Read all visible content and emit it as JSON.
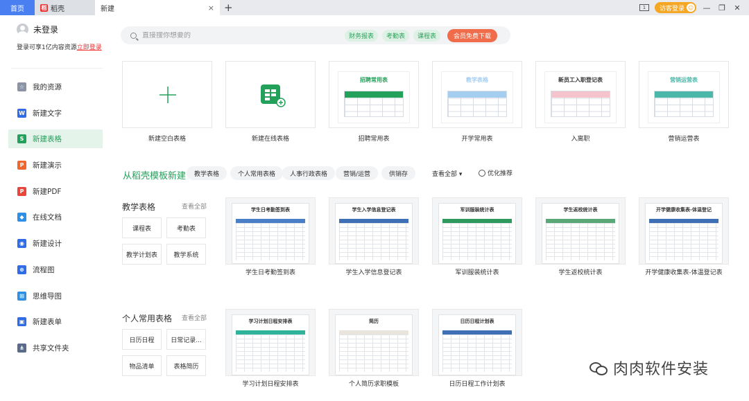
{
  "tabs": {
    "home": "首页",
    "docer": "稻壳",
    "active": "新建",
    "close": "×",
    "add": "+"
  },
  "topbar": {
    "guest_login": "访客登录",
    "min": "—",
    "max": "❐",
    "close": "✕",
    "win_label": "1"
  },
  "user": {
    "name": "未登录",
    "tip": "登录可享1亿内容资源",
    "login_link": "立即登录"
  },
  "nav": [
    {
      "label": "我的资源",
      "color": "#8a94a6",
      "glyph": "☆"
    },
    {
      "label": "新建文字",
      "color": "#2f6ce5",
      "glyph": "W"
    },
    {
      "label": "新建表格",
      "color": "#23a05a",
      "glyph": "S"
    },
    {
      "label": "新建演示",
      "color": "#f0662f",
      "glyph": "P"
    },
    {
      "label": "新建PDF",
      "color": "#e8453c",
      "glyph": "P"
    },
    {
      "label": "在线文档",
      "color": "#2f8fe5",
      "glyph": "◆"
    },
    {
      "label": "新建设计",
      "color": "#2f6ce5",
      "glyph": "◉"
    },
    {
      "label": "流程图",
      "color": "#2f6ce5",
      "glyph": "⊕"
    },
    {
      "label": "思维导图",
      "color": "#2f8fe5",
      "glyph": "⊞"
    },
    {
      "label": "新建表单",
      "color": "#2f6ce5",
      "glyph": "▣"
    },
    {
      "label": "共享文件夹",
      "color": "#5a6a8a",
      "glyph": "⋔"
    }
  ],
  "search": {
    "placeholder": "直接搜你想要的",
    "chips": [
      "财务报表",
      "考勤表",
      "课程表"
    ],
    "vip": "会员免费下载"
  },
  "top_cards": [
    {
      "label": "新建空白表格"
    },
    {
      "label": "新建在线表格"
    },
    {
      "label": "招聘常用表",
      "title": "招聘常用表",
      "accent": "#23a05a"
    },
    {
      "label": "开学常用表",
      "title": "教学表格",
      "accent": "#a5cdf0"
    },
    {
      "label": "入离职",
      "title": "新员工入职登记表",
      "accent": "#f4c3cc"
    },
    {
      "label": "营销运营表",
      "title": "营销运营表",
      "accent": "#4bb7a8"
    }
  ],
  "template_section": {
    "title": "从稻壳模板新建",
    "categories": [
      "教学表格",
      "个人常用表格",
      "人事行政表格",
      "营销/运营",
      "供销存",
      "查看全部 ▾"
    ],
    "optimize": "优化推荐"
  },
  "group1": {
    "title": "教学表格",
    "more": "查看全部",
    "minis": [
      "课程表",
      "考勤表",
      "教学计划表",
      "教学系统"
    ],
    "templates": [
      {
        "label": "学生日考勤签到表",
        "title": "学生日考勤签到表",
        "hdr": "#4a7fc7"
      },
      {
        "label": "学生入学信息登记表",
        "title": "学生入学信息登记表",
        "hdr": "#3f6fb5"
      },
      {
        "label": "军训服装统计表",
        "title": "军训服装统计表",
        "hdr": "#2f9a5e"
      },
      {
        "label": "学生返校统计表",
        "title": "学生返校统计表",
        "hdr": "#5aa878"
      },
      {
        "label": "开学健康收集表-体温登记表",
        "title": "开学健康收集表-体温登记",
        "hdr": "#3f6fb5"
      }
    ]
  },
  "group2": {
    "title": "个人常用表格",
    "more": "查看全部",
    "minis": [
      "日历日程",
      "日常记录...",
      "物品清单",
      "表格简历"
    ],
    "templates": [
      {
        "label": "学习计划日程安排表",
        "title": "学习计划日程安排表",
        "hdr": "#2fb39a"
      },
      {
        "label": "个人简历求职模板",
        "title": "简历",
        "hdr": "#e9e4dc"
      },
      {
        "label": "日历日程工作计划表",
        "title": "日历日程计划表",
        "hdr": "#3f6fb5"
      }
    ]
  },
  "watermark": "肉肉软件安装"
}
